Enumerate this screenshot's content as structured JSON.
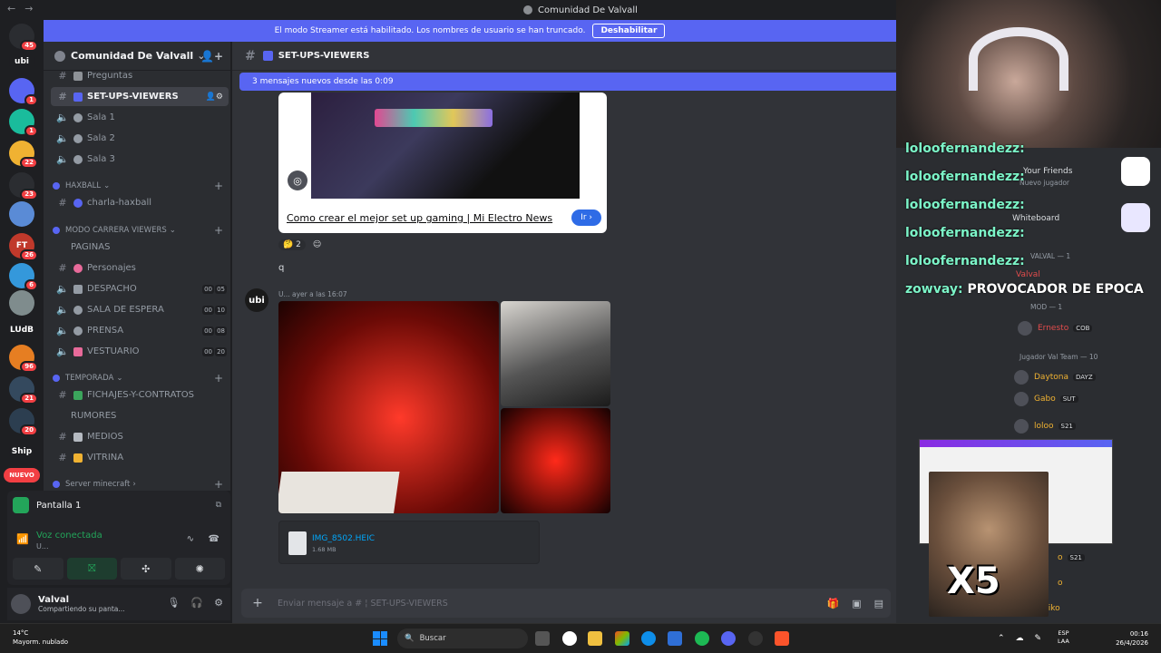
{
  "window": {
    "title": "Comunidad De Valvall"
  },
  "banner": {
    "text": "El modo Streamer está habilitado. Los nombres de usuario se han truncado.",
    "button": "Deshabilitar"
  },
  "guilds": [
    {
      "label": "",
      "badge": "45",
      "color": "#2b2d31"
    },
    {
      "label": "ubi",
      "badge": "",
      "color": "#1e1f22"
    },
    {
      "label": "",
      "badge": "1",
      "color": "#5865f2"
    },
    {
      "label": "",
      "badge": "1",
      "color": "#1abc9c"
    },
    {
      "label": "",
      "badge": "22",
      "color": "#f0b232"
    },
    {
      "label": "",
      "badge": "23",
      "color": "#2b2d31"
    },
    {
      "label": "",
      "badge": "",
      "color": "#5a8bd6"
    },
    {
      "label": "FT",
      "badge": "26",
      "color": "#c0392b"
    },
    {
      "label": "",
      "badge": "6",
      "color": "#3498db"
    },
    {
      "label": "",
      "badge": "",
      "color": "#7f8c8d"
    },
    {
      "label": "LUdB",
      "badge": "",
      "color": "#1e1f22"
    },
    {
      "label": "",
      "badge": "96",
      "color": "#e67e22"
    },
    {
      "label": "",
      "badge": "21",
      "color": "#34495e"
    },
    {
      "label": "",
      "badge": "20",
      "color": "#2c3e50"
    },
    {
      "label": "Ship",
      "badge": "",
      "color": "#1e1f22"
    }
  ],
  "new_badge": "NUEVO",
  "server": {
    "name": "Comunidad De Valvall"
  },
  "channels": [
    {
      "kind": "text",
      "label": "Preguntas",
      "emoji_color": "#8e9297"
    },
    {
      "kind": "text",
      "label": "SET-UPS-VIEWERS",
      "emoji_color": "#5865f2",
      "selected": true
    },
    {
      "kind": "voice",
      "label": "Sala 1"
    },
    {
      "kind": "voice",
      "label": "Sala 2"
    },
    {
      "kind": "voice",
      "label": "Sala 3"
    }
  ],
  "categories": {
    "haxball": "haxball",
    "modo_carrera": "MODO CARRERA VIEWERS",
    "temporada": "TEMPORADA",
    "server_minecraft": "Server minecraft"
  },
  "haxball_channels": [
    {
      "label": "charla-haxball"
    }
  ],
  "modo_carrera_channels": [
    {
      "label": "PAGINAS",
      "kind": "plain"
    },
    {
      "label": "Personajes",
      "kind": "text",
      "emoji_color": "#e86a9a"
    },
    {
      "label": "DESPACHO",
      "kind": "voice",
      "c1": "00",
      "c2": "05"
    },
    {
      "label": "SALA DE ESPERA",
      "kind": "voice",
      "c1": "00",
      "c2": "10"
    },
    {
      "label": "PRENSA",
      "kind": "voice",
      "c1": "00",
      "c2": "08"
    },
    {
      "label": "VESTUARIO",
      "kind": "voice",
      "c1": "00",
      "c2": "20"
    }
  ],
  "temporada_channels": [
    {
      "label": "FICHAJES-Y-CONTRATOS",
      "kind": "text",
      "emoji_color": "#3ba55c"
    },
    {
      "label": "RUMORES",
      "kind": "plain"
    },
    {
      "label": "MEDIOS",
      "kind": "text",
      "emoji_color": "#b5bac1"
    },
    {
      "label": "VITRINA",
      "kind": "text",
      "emoji_color": "#f0b232"
    }
  ],
  "voice": {
    "screen": "Pantalla 1",
    "status": "Voz conectada",
    "sub": "U..."
  },
  "user": {
    "name": "Valval",
    "status": "Compartiendo su panta..."
  },
  "channel_header": {
    "name": "SET-UPS-VIEWERS"
  },
  "new_messages": "3 mensajes nuevos desde las 0:09",
  "embed": {
    "link": "Como crear el mejor set up gaming | Mi Electro News",
    "button": "Ir"
  },
  "reaction": {
    "count": "2"
  },
  "message_q": "q",
  "message2": {
    "avatar": "ubi",
    "meta": "U...   ayer a las 16:07"
  },
  "file": {
    "name": "IMG_8502.HEIC",
    "size": "1.68 MB"
  },
  "composer": {
    "placeholder": "Enviar mensaje a #  ¦ SET-UPS-VIEWERS"
  },
  "chat": [
    {
      "user": "loloofernandezz:",
      "msg": ""
    },
    {
      "user": "loloofernandezz:",
      "msg": ""
    },
    {
      "user": "loloofernandezz:",
      "msg": ""
    },
    {
      "user": "loloofernandezz:",
      "msg": ""
    },
    {
      "user": "loloofernandezz:",
      "msg": ""
    },
    {
      "user": "zowvay:",
      "msg": "PROVOCADOR DE EPOCA"
    }
  ],
  "members": {
    "golf_title": "Your Friends",
    "golf_sub": "Nuevo jugador",
    "whiteboard": "Whiteboard",
    "valval_group": "VALVAL — 1",
    "valval": "Valval",
    "mod_group": "MOD — 1",
    "ernesto": "Ernesto",
    "ernesto_tag": "COB",
    "team_group": "Jugador Val Team — 10",
    "m1": "Daytona",
    "m1tag": "DAYZ",
    "m2": "Gabo",
    "m2tag": "SUT",
    "m3": "loloo",
    "m3tag": "S21",
    "m4": "o",
    "m4tag": "S21",
    "m5": "o",
    "m6": "Zeiko"
  },
  "meme_text": "X5",
  "taskbar": {
    "weather_temp": "14°C",
    "weather_desc": "Mayorm. nublado",
    "search": "Buscar",
    "lang1": "ESP",
    "lang2": "LAA",
    "time": "00:16",
    "date": "26/4/2026"
  }
}
